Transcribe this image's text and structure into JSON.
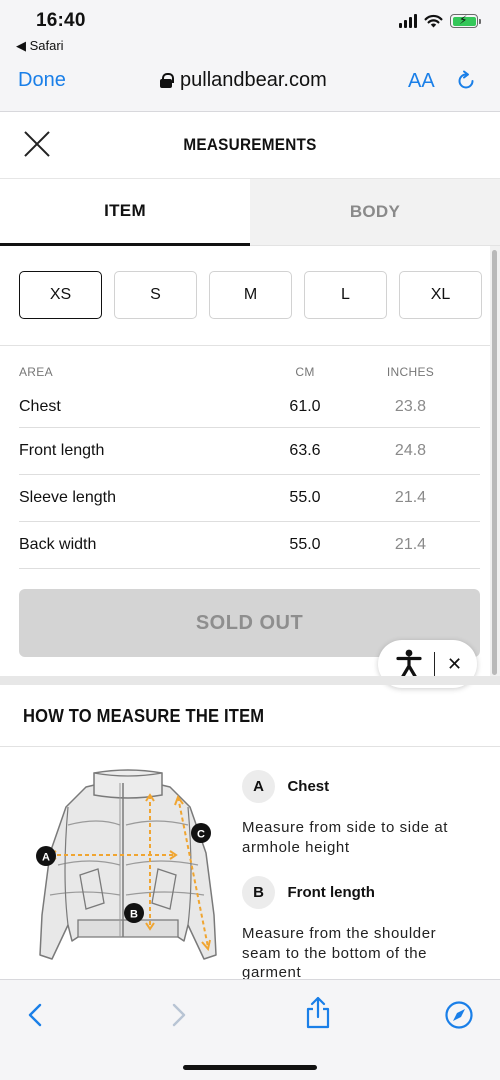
{
  "status_bar": {
    "time": "16:40",
    "back_app": "◀ Safari"
  },
  "browser": {
    "done_label": "Done",
    "url": "pullandbear.com",
    "text_size_label": "AA"
  },
  "modal": {
    "title": "MEASUREMENTS"
  },
  "tabs": [
    {
      "label": "ITEM",
      "active": true
    },
    {
      "label": "BODY",
      "active": false
    }
  ],
  "sizes": [
    {
      "label": "XS",
      "selected": true
    },
    {
      "label": "S",
      "selected": false
    },
    {
      "label": "M",
      "selected": false
    },
    {
      "label": "L",
      "selected": false
    },
    {
      "label": "XL",
      "selected": false
    }
  ],
  "table": {
    "headers": {
      "area": "AREA",
      "cm": "CM",
      "inches": "INCHES"
    },
    "rows": [
      {
        "area": "Chest",
        "cm": "61.0",
        "inches": "23.8"
      },
      {
        "area": "Front length",
        "cm": "63.6",
        "inches": "24.8"
      },
      {
        "area": "Sleeve length",
        "cm": "55.0",
        "inches": "21.4"
      },
      {
        "area": "Back width",
        "cm": "55.0",
        "inches": "21.4"
      }
    ]
  },
  "sold_out_label": "SOLD OUT",
  "accessibility_widget": {
    "close": "✕"
  },
  "how_to_measure": {
    "title": "HOW TO MEASURE THE ITEM",
    "diagram_labels": {
      "a": "A",
      "b": "B",
      "c": "C"
    },
    "items": [
      {
        "letter": "A",
        "name": "Chest",
        "desc_lines": [
          "Measure from side to side at",
          "armhole height"
        ]
      },
      {
        "letter": "B",
        "name": "Front length",
        "desc_lines": [
          "Measure from the shoulder",
          "seam to the bottom of the",
          "garment"
        ]
      }
    ]
  },
  "colors": {
    "ios_blue": "#1a7fe8",
    "measure_orange": "#f0a531",
    "battery_green": "#34c759"
  },
  "icons": [
    "lock-icon",
    "reload-icon",
    "close-icon",
    "accessibility-icon",
    "back-icon",
    "forward-icon",
    "share-icon",
    "compass-icon"
  ]
}
